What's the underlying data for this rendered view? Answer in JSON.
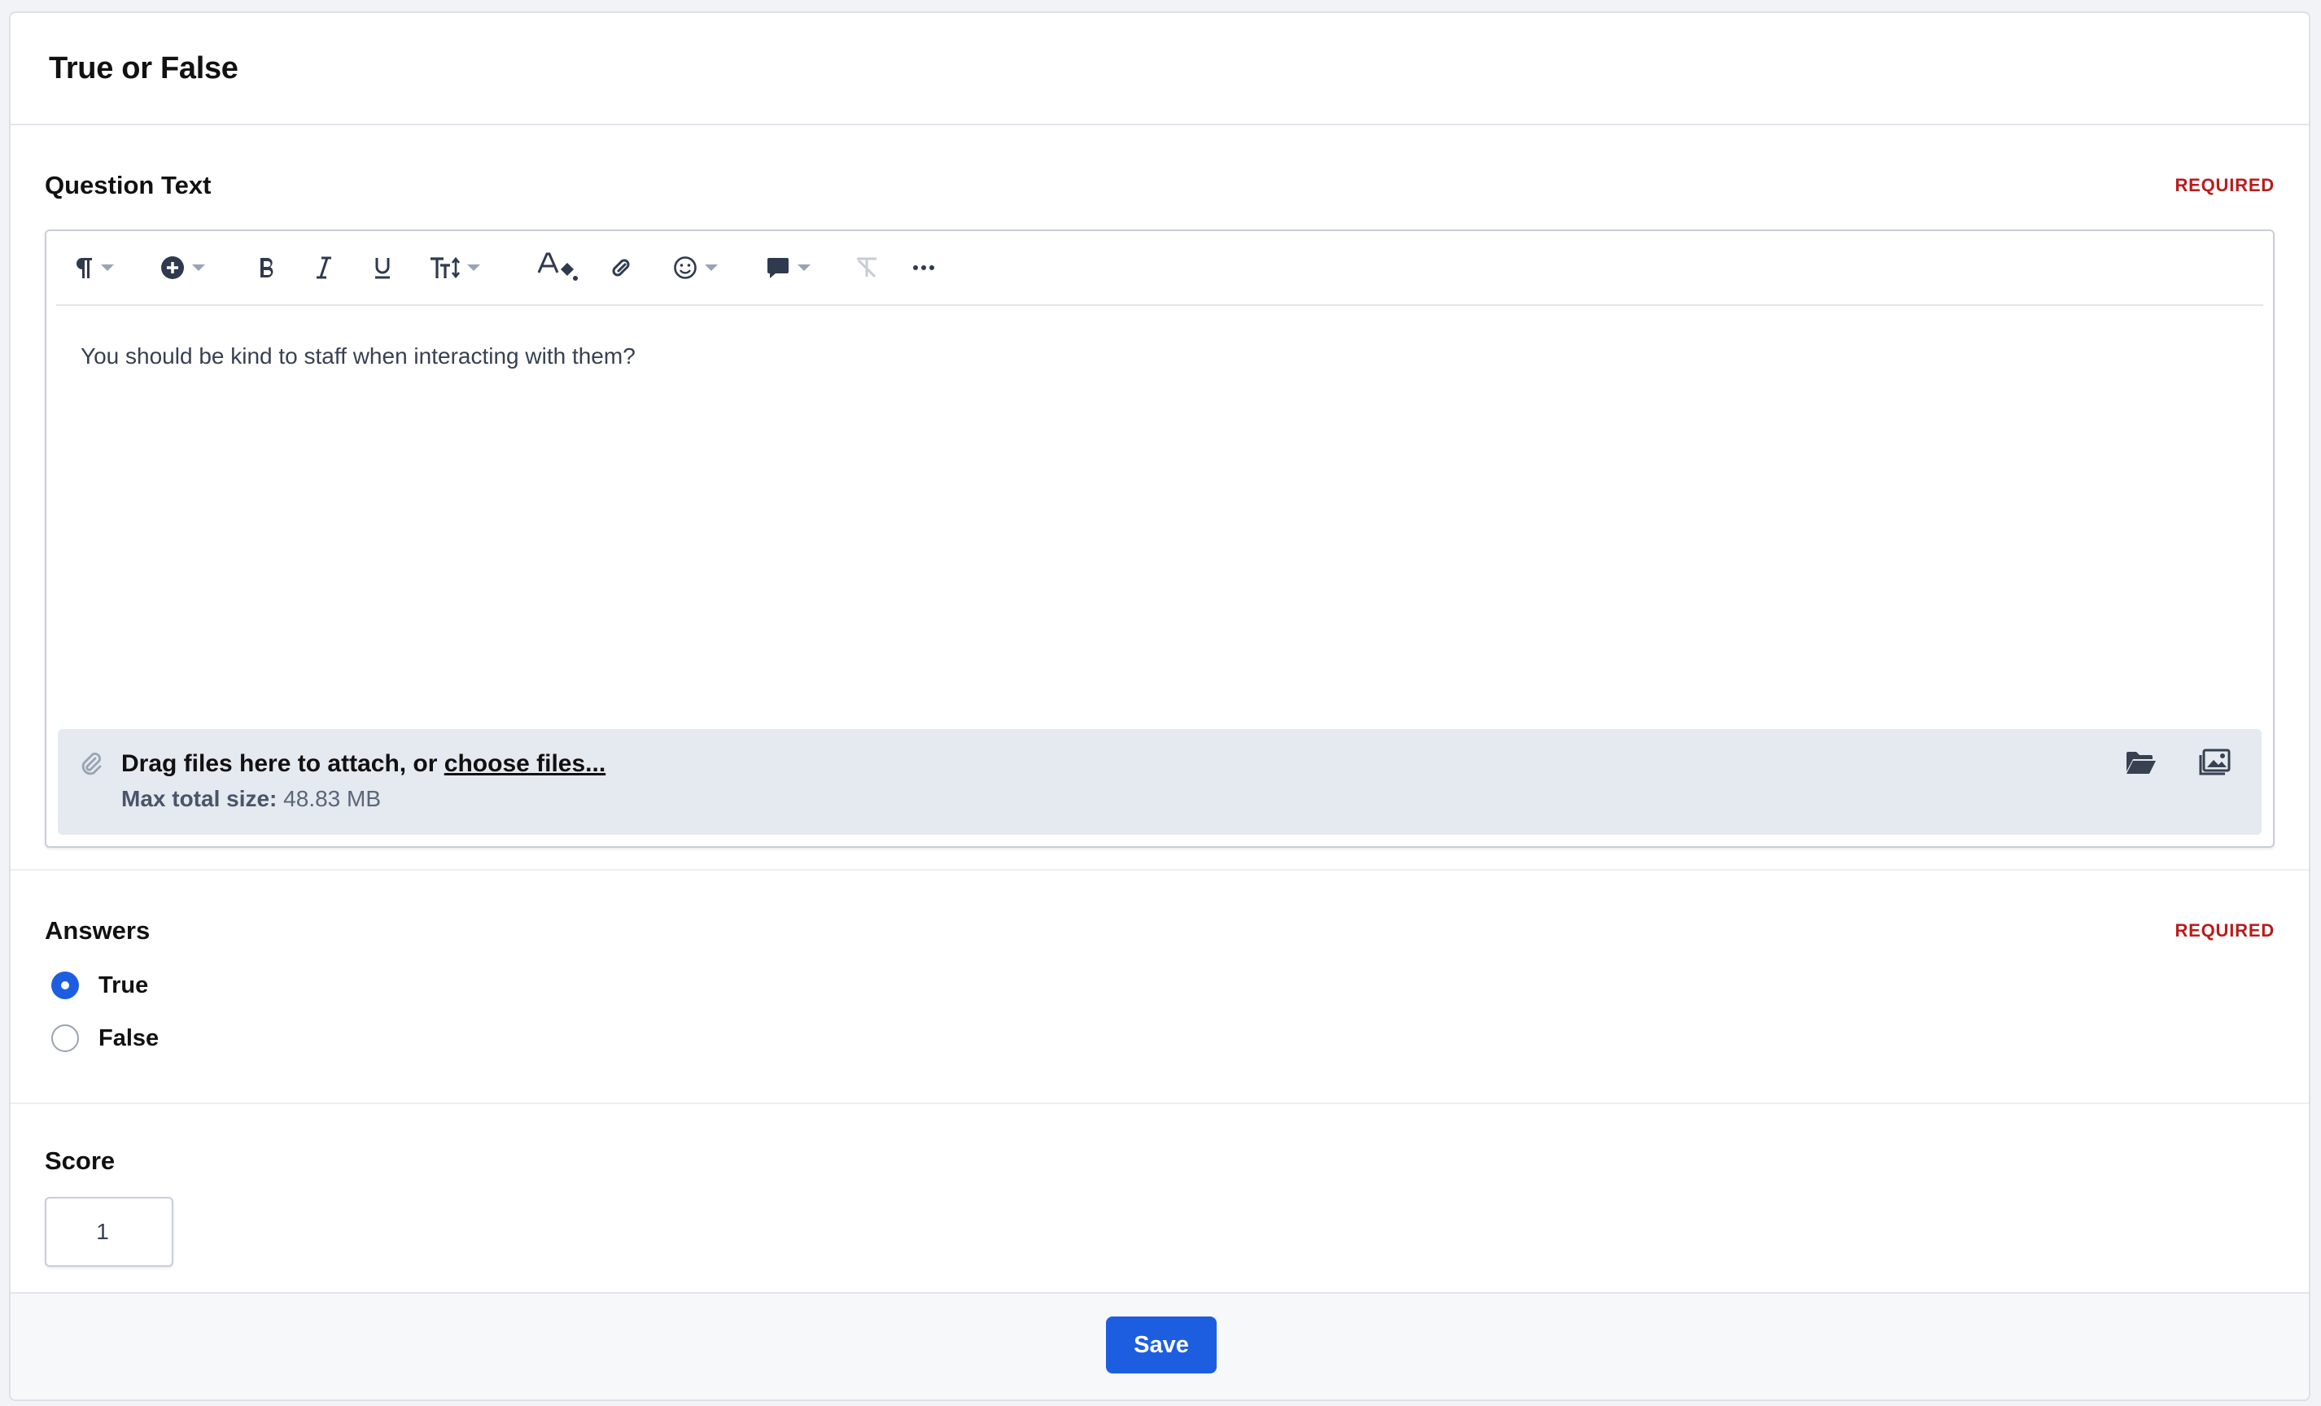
{
  "page": {
    "title": "True or False"
  },
  "question_text": {
    "label": "Question Text",
    "required_badge": "REQUIRED",
    "body": "You should be kind to staff when interacting with them?",
    "toolbar": [
      "paragraph-icon",
      "insert-icon",
      "bold-icon",
      "italic-icon",
      "underline-icon",
      "text-size-icon",
      "text-color-icon",
      "link-icon",
      "emoji-icon",
      "comment-icon",
      "clear-format-icon",
      "more-icon"
    ],
    "attach": {
      "prefix": "Drag files here to attach, or ",
      "link": "choose files...",
      "max_label": "Max total size:",
      "max_value": "48.83 MB"
    }
  },
  "answers": {
    "label": "Answers",
    "required_badge": "REQUIRED",
    "options": [
      {
        "label": "True",
        "selected": true
      },
      {
        "label": "False",
        "selected": false
      }
    ]
  },
  "score": {
    "label": "Score",
    "value": "1"
  },
  "footer": {
    "save_label": "Save"
  },
  "colors": {
    "accent": "#1d5ee0",
    "required": "#b91c1c"
  }
}
